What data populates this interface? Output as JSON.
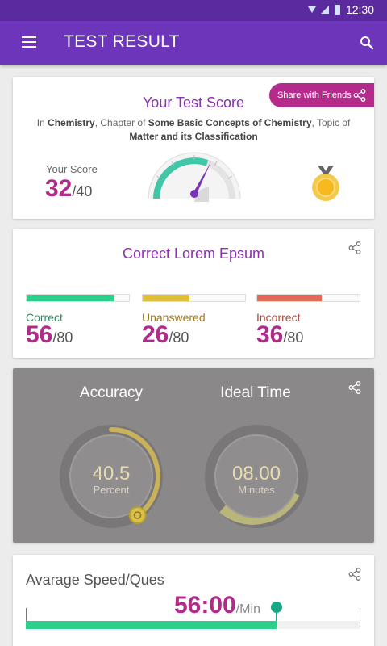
{
  "status_bar": {
    "time": "12:30"
  },
  "app_bar": {
    "title": "TEST RESULT"
  },
  "score_card": {
    "share_label": "Share with Friends",
    "title": "Your Test Score",
    "subtitle": {
      "prefix": "In ",
      "subject": "Chemistry",
      "mid1": ", Chapter of ",
      "chapter": "Some Basic Concepts of Chemistry",
      "mid2": ", Topic of ",
      "topic": "Matter and its Classification"
    },
    "your_score_label": "Your Score",
    "score": "32",
    "total": "/40"
  },
  "correct_card": {
    "title": "Correct Lorem Epsum",
    "stats": [
      {
        "label": "Correct",
        "value": "56",
        "total": "/80",
        "fill": 0.86,
        "color": "#2ccf8c"
      },
      {
        "label": "Unanswered",
        "value": "26",
        "total": "/80",
        "fill": 0.46,
        "color": "#e0be3d"
      },
      {
        "label": "Incorrect",
        "value": "36",
        "total": "/80",
        "fill": 0.63,
        "color": "#e06b56"
      }
    ]
  },
  "metrics_card": {
    "accuracy_label": "Accuracy",
    "accuracy_value": "40.5",
    "accuracy_unit": "Percent",
    "accuracy_fraction": 0.405,
    "ideal_time_label": "Ideal Time",
    "ideal_time_value": "08.00",
    "ideal_time_unit": "Minutes"
  },
  "speed_card": {
    "title": "Avarage Speed/Ques",
    "value": "56:00",
    "unit": "/Min",
    "fill": 0.75
  },
  "colors": {
    "primary": "#6d35b9",
    "accent": "#b52b8c",
    "green": "#2ccf8c"
  }
}
